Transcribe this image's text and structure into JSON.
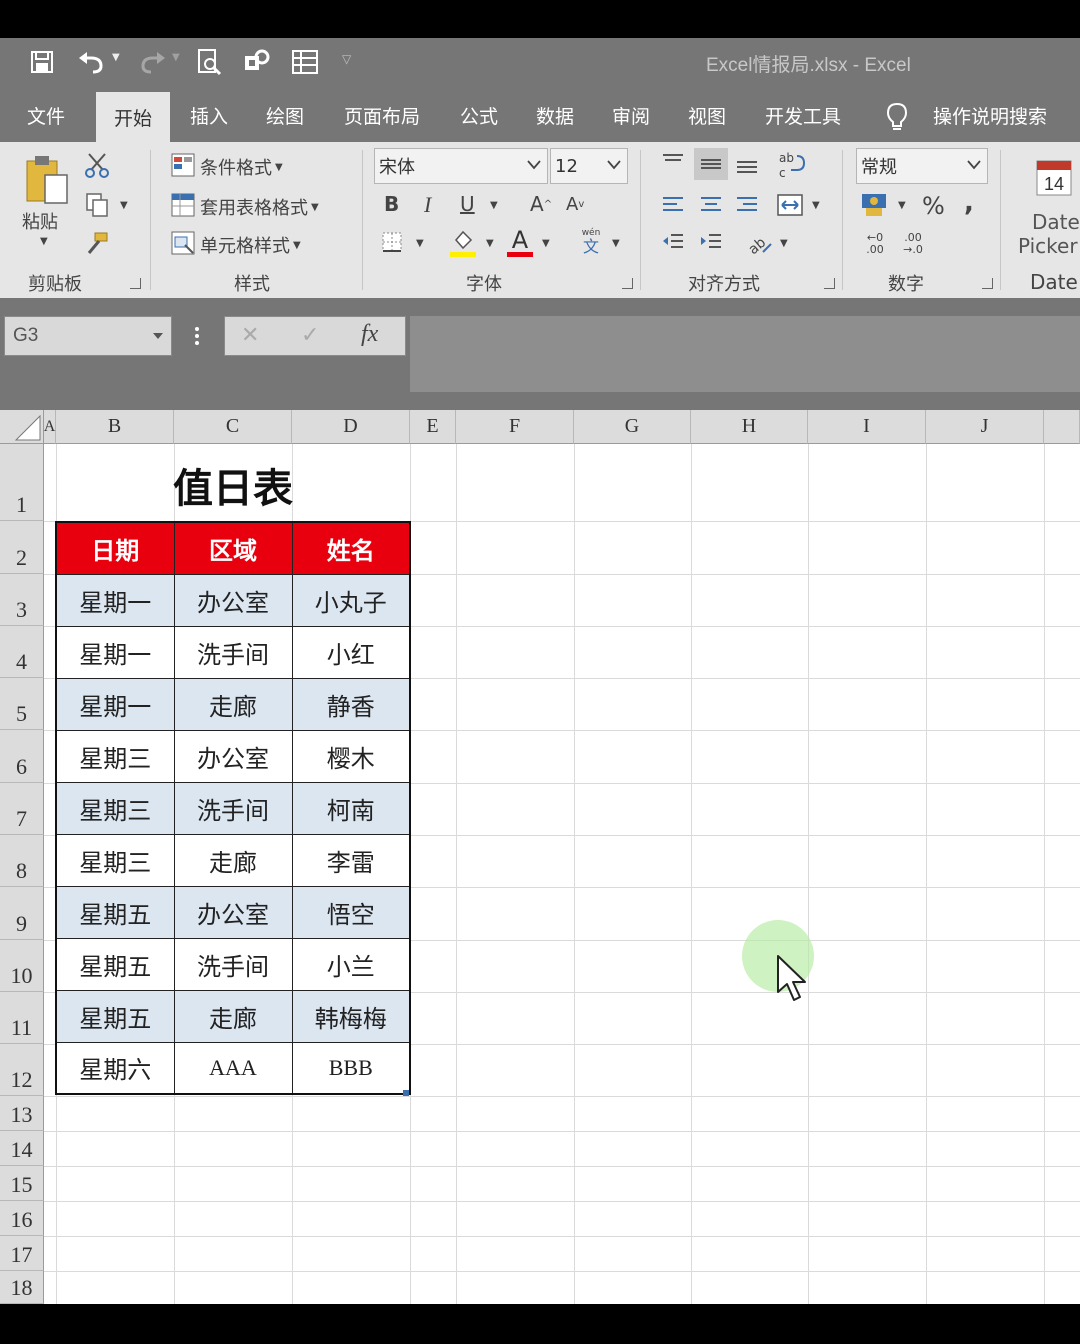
{
  "window": {
    "title": "Excel情报局.xlsx  -  Excel"
  },
  "qat": {
    "icons": [
      "save-icon",
      "undo-icon",
      "redo-icon",
      "print-preview-icon",
      "addin-icon",
      "form-icon",
      "customize-icon"
    ]
  },
  "tabs": [
    {
      "label": "文件",
      "active": false
    },
    {
      "label": "开始",
      "active": true
    },
    {
      "label": "插入",
      "active": false
    },
    {
      "label": "绘图",
      "active": false
    },
    {
      "label": "页面布局",
      "active": false
    },
    {
      "label": "公式",
      "active": false
    },
    {
      "label": "数据",
      "active": false
    },
    {
      "label": "审阅",
      "active": false
    },
    {
      "label": "视图",
      "active": false
    },
    {
      "label": "开发工具",
      "active": false
    }
  ],
  "tell_me": "操作说明搜索",
  "ribbon": {
    "clipboard": {
      "paste": "粘贴",
      "label": "剪贴板"
    },
    "styles": {
      "conditional": "条件格式",
      "table_format": "套用表格格式",
      "cell_styles": "单元格样式",
      "label": "样式"
    },
    "font": {
      "name": "宋体",
      "size": "12",
      "bold": "B",
      "italic": "I",
      "underline": "U",
      "grow": "A",
      "shrink": "A",
      "font_color_letter": "A",
      "phonetic": "wén",
      "phonetic_char": "文",
      "label": "字体"
    },
    "alignment": {
      "wrap": "ab\nc",
      "label": "对齐方式"
    },
    "number": {
      "format": "常规",
      "percent": "%",
      "comma": ",",
      "inc_top": "←0",
      "inc_bot": ".00",
      "dec_top": ".00",
      "dec_bot": "→.0",
      "label": "数字"
    },
    "date": {
      "calendar_day": "14",
      "line1": "Date",
      "line2": "Picker",
      "label": "Date"
    }
  },
  "formula_bar": {
    "name_box": "G3",
    "cancel": "✕",
    "enter": "✓",
    "fx": "fx",
    "content": ""
  },
  "columns": [
    "A",
    "B",
    "C",
    "D",
    "E",
    "F",
    "G",
    "H",
    "I",
    "J"
  ],
  "rows": [
    "1",
    "2",
    "3",
    "4",
    "5",
    "6",
    "7",
    "8",
    "9",
    "10",
    "11",
    "12",
    "13",
    "14",
    "15",
    "16",
    "17",
    "18"
  ],
  "sheet": {
    "title": "值日表",
    "headers": [
      "日期",
      "区域",
      "姓名"
    ],
    "data": [
      [
        "星期一",
        "办公室",
        "小丸子"
      ],
      [
        "星期一",
        "洗手间",
        "小红"
      ],
      [
        "星期一",
        "走廊",
        "静香"
      ],
      [
        "星期三",
        "办公室",
        "樱木"
      ],
      [
        "星期三",
        "洗手间",
        "柯南"
      ],
      [
        "星期三",
        "走廊",
        "李雷"
      ],
      [
        "星期五",
        "办公室",
        "悟空"
      ],
      [
        "星期五",
        "洗手间",
        "小兰"
      ],
      [
        "星期五",
        "走廊",
        "韩梅梅"
      ],
      [
        "星期六",
        "AAA",
        "BBB"
      ]
    ]
  },
  "colors": {
    "header_red": "#e8000f",
    "band_blue": "#dce6f1",
    "chrome_gray": "#767676"
  }
}
